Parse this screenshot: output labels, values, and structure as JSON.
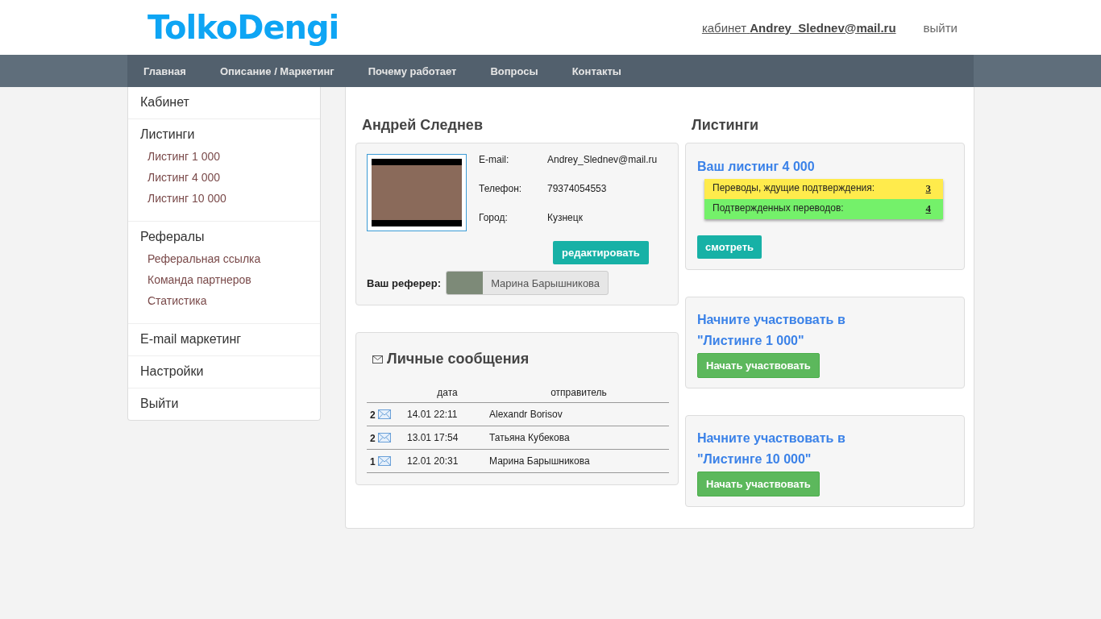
{
  "header": {
    "logo": "TolkoDengi",
    "account_prefix": "кабинет",
    "account_email": "Andrey_Slednev@mail.ru",
    "logout": "выйти"
  },
  "nav": [
    "Главная",
    "Описание / Маркетинг",
    "Почему работает",
    "Вопросы",
    "Контакты"
  ],
  "sidebar": [
    {
      "label": "Кабинет"
    },
    {
      "label": "Листинги",
      "children": [
        "Листинг 1 000",
        "Листинг 4 000",
        "Листинг 10 000"
      ]
    },
    {
      "label": "Рефералы",
      "children": [
        "Реферальная ссылка",
        "Команда партнеров",
        "Статистика"
      ]
    },
    {
      "label": "E-mail маркетинг"
    },
    {
      "label": "Настройки"
    },
    {
      "label": "Выйти"
    }
  ],
  "profile": {
    "title": "Андрей Следнев",
    "fields": [
      {
        "label": "E-mail:",
        "value": "Andrey_Slednev@mail.ru"
      },
      {
        "label": "Телефон:",
        "value": "79374054553"
      },
      {
        "label": "Город:",
        "value": "Кузнецк"
      }
    ],
    "edit_button": "редактировать",
    "referrer_label": "Ваш реферер:",
    "referrer_name": "Марина Барышникова"
  },
  "messages": {
    "title": "Личные сообщения",
    "columns": [
      "дата",
      "отправитель"
    ],
    "rows": [
      {
        "count": "2",
        "date": "14.01 22:11",
        "sender": "Alexandr Borisov"
      },
      {
        "count": "2",
        "date": "13.01 17:54",
        "sender": "Татьяна Кубекова"
      },
      {
        "count": "1",
        "date": "12.01 20:31",
        "sender": "Марина Барышникова"
      }
    ]
  },
  "listings": {
    "title": "Листинги",
    "current": {
      "title": "Ваш листинг 4 000",
      "stats": [
        {
          "label": "Переводы, ждущие подтверждения:",
          "value": "3",
          "color": "#ffeb4c"
        },
        {
          "label": "Подтвержденных переводов:",
          "value": "4",
          "color": "#74f16a"
        }
      ],
      "button": "смотреть"
    },
    "offers": [
      {
        "title_line1": "Начните участвовать в",
        "title_line2": "\"Листинге 1 000\"",
        "button": "Начать участвовать"
      },
      {
        "title_line1": "Начните участвовать в",
        "title_line2": "\"Листинге 10 000\"",
        "button": "Начать участвовать"
      }
    ]
  }
}
